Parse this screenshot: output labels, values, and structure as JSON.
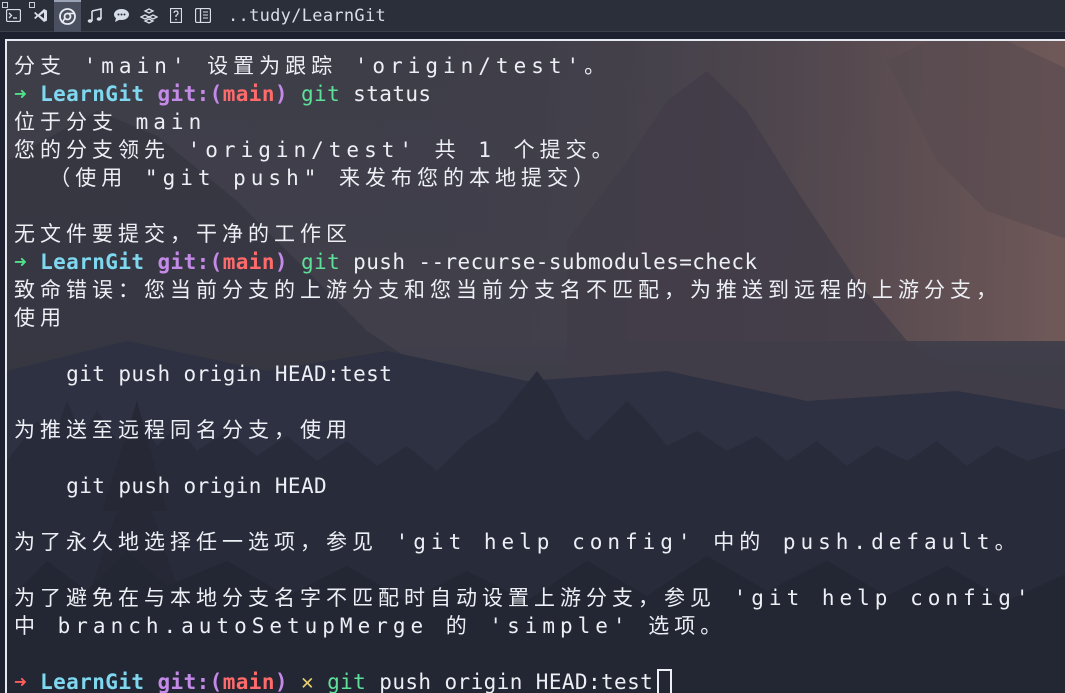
{
  "topbar": {
    "title": "..tudy/LearnGit",
    "icons": [
      "terminal-icon",
      "vscode-icon",
      "chrome-icon",
      "music-icon",
      "chat-icon",
      "apps-grid-icon",
      "help-icon",
      "reader-icon"
    ]
  },
  "prompt": {
    "arrow": "➜",
    "dir": "LearnGit",
    "git_prefix": "git:(",
    "branch": "main",
    "git_suffix": ")",
    "dirty_mark": "✕"
  },
  "terminal": {
    "line1": "分支 'main' 设置为跟踪 'origin/test'。",
    "cmd1_git": "git",
    "cmd1_rest": " status",
    "line3": "位于分支 main",
    "line4": "您的分支领先 'origin/test' 共 1 个提交。",
    "line5": "  （使用 \"git push\" 来发布您的本地提交）",
    "line7": "无文件要提交，干净的工作区",
    "cmd2_git": "git",
    "cmd2_rest": " push --recurse-submodules=check",
    "line9": "致命错误：您当前分支的上游分支和您当前分支名不匹配，为推送到远程的上游分支，",
    "line10": "使用",
    "line12": "    git push origin HEAD:test",
    "line14": "为推送至远程同名分支，使用",
    "line16": "    git push origin HEAD",
    "line18": "为了永久地选择任一选项，参见 'git help config' 中的 push.default。",
    "line20": "为了避免在与本地分支名字不匹配时自动设置上游分支，参见 'git help config'",
    "line21": "中 branch.autoSetupMerge 的 'simple' 选项。",
    "cmd3_git": "git",
    "cmd3_rest": " push origin HEAD:test"
  },
  "colors": {
    "prompt_ok": "#50e08a",
    "prompt_err": "#ff5c5c",
    "dir": "#7fd8ef",
    "git_keyword": "#c48ae8",
    "branch": "#ff6a6a",
    "command": "#5ee09a"
  }
}
